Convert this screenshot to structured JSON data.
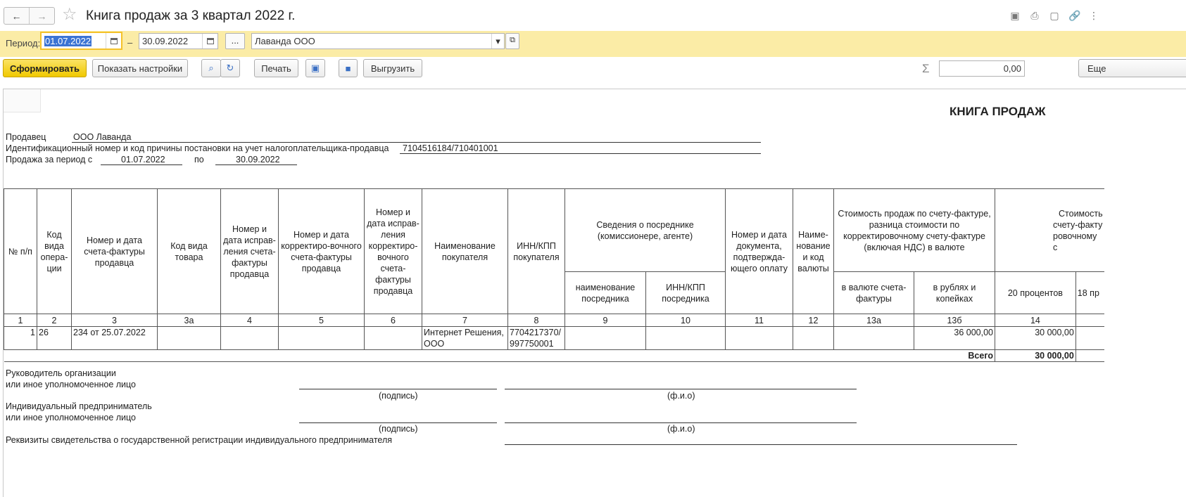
{
  "window": {
    "title": "Книга продаж за 3 квартал 2022 г."
  },
  "period": {
    "label": "Период:",
    "from": "01.07.2022",
    "dash": "–",
    "to": "30.09.2022",
    "more": "...",
    "organization": "Лаванда ООО"
  },
  "toolbar": {
    "generate": "Сформировать",
    "show_settings": "Показать настройки",
    "print": "Печать",
    "export": "Выгрузить",
    "sum_symbol": "Σ",
    "sum_value": "0,00",
    "more": "Еще"
  },
  "report": {
    "heading": "КНИГА ПРОДАЖ",
    "seller_label": "Продавец",
    "seller_value": "ООО Лаванда",
    "inn_label": "Идентификационный номер и код причины постановки на учет налогоплательщика-продавца",
    "inn_value": "7104516184/710401001",
    "period_label": "Продажа за период с",
    "period_from": "01.07.2022",
    "period_to_label": "по",
    "period_to": "30.09.2022",
    "table": {
      "headers": {
        "c1": "№ п/п",
        "c2": "Код вида опера-ции",
        "c3": "Номер и дата счета-фактуры продавца",
        "c3a": "Код вида товара",
        "c4": "Номер и дата исправ-ления счета-фактуры продавца",
        "c5": "Номер и дата корректиро-вочного счета-фактуры продавца",
        "c6": "Номер и дата исправ-ления корректиро-вочного счета-фактуры продавца",
        "c7": "Наименование покупателя",
        "c8": "ИНН/КПП покупателя",
        "g9": "Сведения о посреднике (комиссионере, агенте)",
        "c9": "наименование посредника",
        "c10": "ИНН/КПП посредника",
        "c11": "Номер и дата документа, подтвержда-ющего оплату",
        "c12": "Наиме-нование и код валюты",
        "g13": "Стоимость продаж по счету-фактуре, разница стоимости по корректировочному счету-фактуре (включая НДС) в валюте",
        "c13a": "в валюте счета-фактуры",
        "c13b": "в рублях и копейках",
        "g14": "Стоимость",
        "g14b": "счету-факту",
        "g14c": "ровочному с",
        "c14": "20 процентов",
        "c15": "18 пр"
      },
      "numbers": [
        "1",
        "2",
        "3",
        "3а",
        "4",
        "5",
        "6",
        "7",
        "8",
        "9",
        "10",
        "11",
        "12",
        "13а",
        "13б",
        "14",
        ""
      ],
      "rows": [
        {
          "n": "1",
          "op": "26",
          "invoice": "234 от 25.07.2022",
          "buyer": "Интернет Решения, ООО",
          "buyer_inn": "7704217370/ 997750001",
          "sum_rub": "36 000,00",
          "base20": "30 000,00"
        }
      ],
      "total_label": "Всего",
      "total_base20": "30 000,00"
    },
    "sign": {
      "head_l1": "Руководитель организации",
      "head_l2": "или иное уполномоченное лицо",
      "sign_caption": "(подпись)",
      "fio_caption": "(ф.и.о)",
      "ip_l1": "Индивидуальный предприниматель",
      "ip_l2": "или иное уполномоченное лицо",
      "requisites": "Реквизиты свидетельства о государственной регистрации индивидуального предпринимателя"
    }
  }
}
